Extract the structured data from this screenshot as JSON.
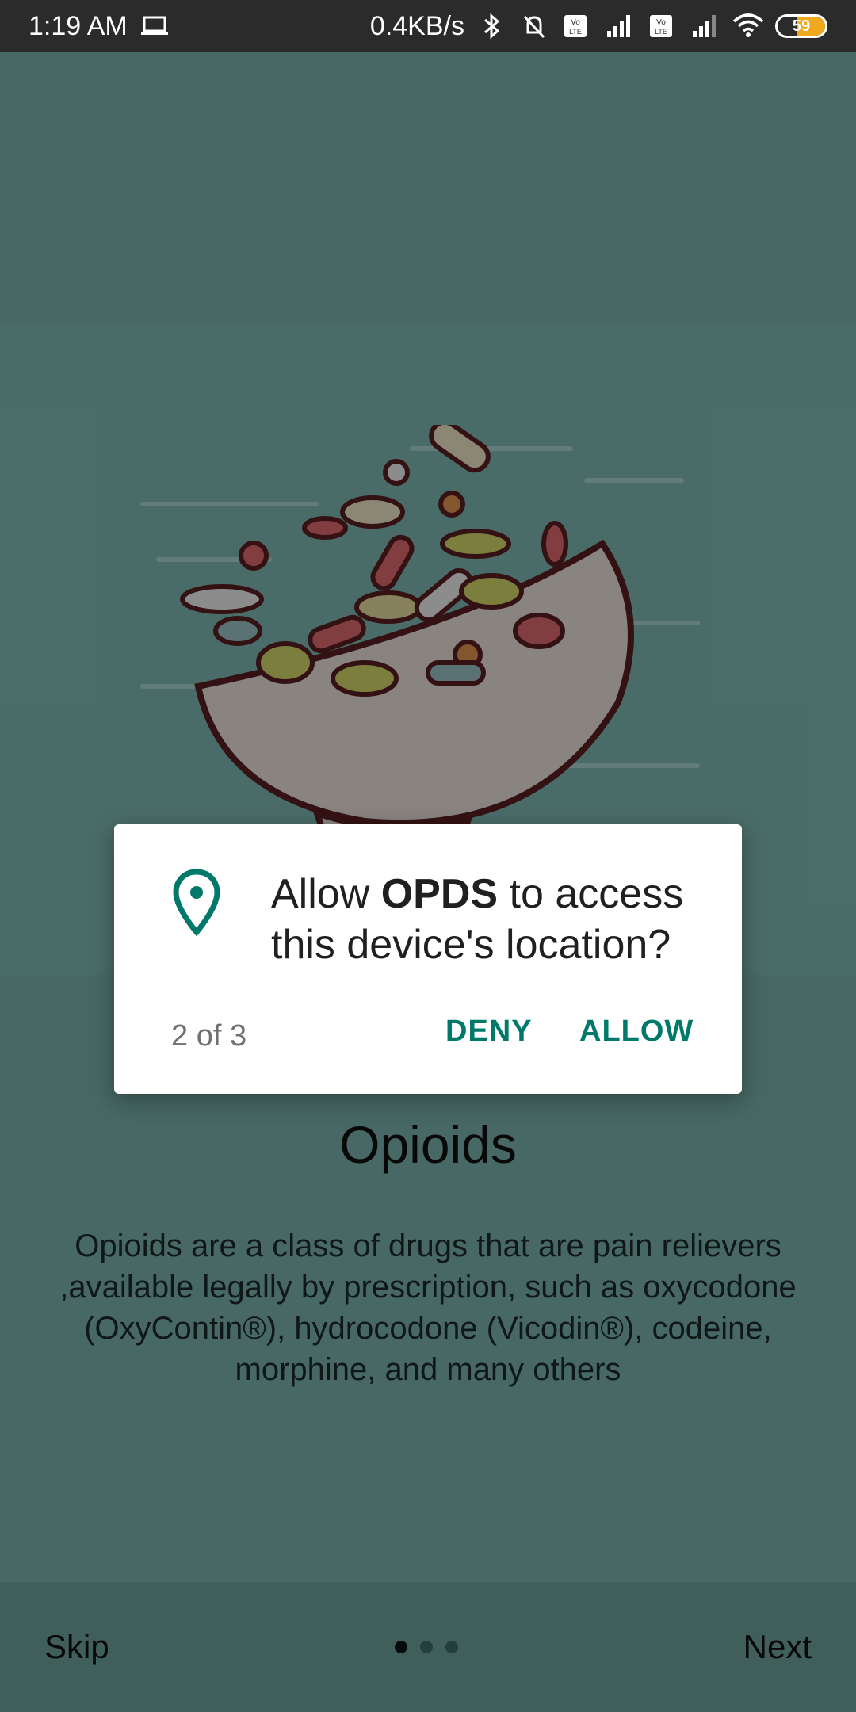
{
  "status_bar": {
    "time": "1:19 AM",
    "network_speed": "0.4KB/s",
    "battery_level": "59",
    "icons": [
      "laptop-icon",
      "bluetooth-icon",
      "mute-icon",
      "volte-icon",
      "signal-icon",
      "volte-icon",
      "signal-icon",
      "wifi-icon",
      "battery-icon"
    ]
  },
  "onboarding": {
    "title": "Opioids",
    "description": "Opioids are a class of drugs that are pain relievers ,available legally by prescription, such as oxycodone (OxyContin®), hydrocodone (Vicodin®), codeine, morphine, and many others",
    "skip_label": "Skip",
    "next_label": "Next",
    "page_indicator": {
      "count": 3,
      "active": 1
    }
  },
  "dialog": {
    "prefix": "Allow ",
    "app_name": "OPDS",
    "suffix": " to access this device's location?",
    "counter": "2 of 3",
    "deny_label": "DENY",
    "allow_label": "ALLOW",
    "icon": "location-pin-icon",
    "accent_color": "#00796b"
  },
  "colors": {
    "background": "#7bb3ad",
    "status_bar": "#2b2b2b"
  }
}
